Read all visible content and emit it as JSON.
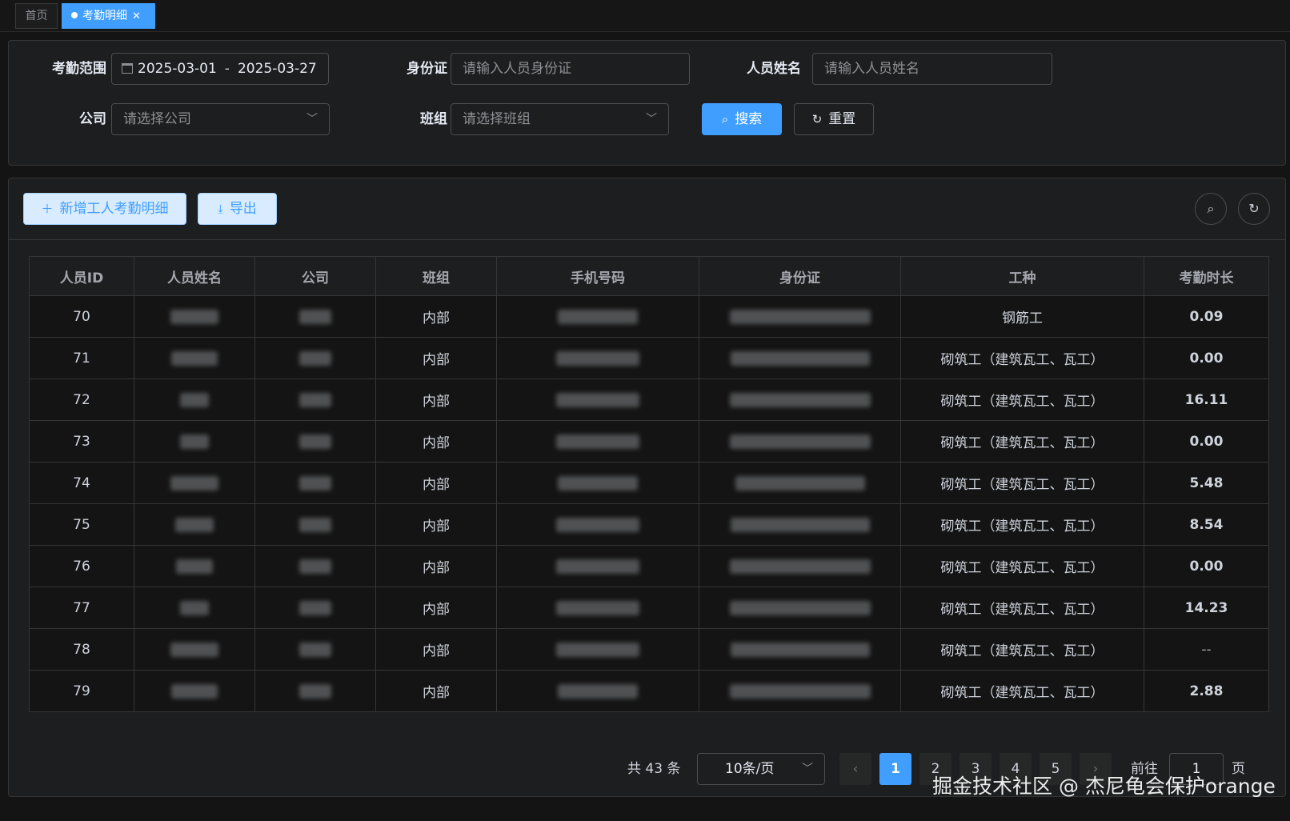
{
  "tabs": [
    {
      "label": "首页",
      "active": false
    },
    {
      "label": "考勤明细",
      "active": true
    }
  ],
  "search": {
    "range_label": "考勤范围",
    "date_start": "2025-03-01",
    "date_sep": "-",
    "date_end": "2025-03-27",
    "idcard_label": "身份证",
    "idcard_placeholder": "请输入人员身份证",
    "name_label": "人员姓名",
    "name_placeholder": "请输入人员姓名",
    "company_label": "公司",
    "company_placeholder": "请选择公司",
    "team_label": "班组",
    "team_placeholder": "请选择班组",
    "search_btn": "搜索",
    "reset_btn": "重置"
  },
  "toolbar": {
    "add_btn": "新增工人考勤明细",
    "export_btn": "导出"
  },
  "table": {
    "columns": [
      "人员ID",
      "人员姓名",
      "公司",
      "班组",
      "手机号码",
      "身份证",
      "工种",
      "考勤时长"
    ],
    "rows": [
      {
        "id": "70",
        "team": "内部",
        "trade": "钢筋工",
        "duration": "0.09"
      },
      {
        "id": "71",
        "team": "内部",
        "trade": "砌筑工（建筑瓦工、瓦工）",
        "duration": "0.00"
      },
      {
        "id": "72",
        "team": "内部",
        "trade": "砌筑工（建筑瓦工、瓦工）",
        "duration": "16.11"
      },
      {
        "id": "73",
        "team": "内部",
        "trade": "砌筑工（建筑瓦工、瓦工）",
        "duration": "0.00"
      },
      {
        "id": "74",
        "team": "内部",
        "trade": "砌筑工（建筑瓦工、瓦工）",
        "duration": "5.48"
      },
      {
        "id": "75",
        "team": "内部",
        "trade": "砌筑工（建筑瓦工、瓦工）",
        "duration": "8.54"
      },
      {
        "id": "76",
        "team": "内部",
        "trade": "砌筑工（建筑瓦工、瓦工）",
        "duration": "0.00"
      },
      {
        "id": "77",
        "team": "内部",
        "trade": "砌筑工（建筑瓦工、瓦工）",
        "duration": "14.23"
      },
      {
        "id": "78",
        "team": "内部",
        "trade": "砌筑工（建筑瓦工、瓦工）",
        "duration": "--"
      },
      {
        "id": "79",
        "team": "内部",
        "trade": "砌筑工（建筑瓦工、瓦工）",
        "duration": "2.88"
      }
    ]
  },
  "pagination": {
    "total_text": "共 43 条",
    "page_size": "10条/页",
    "pages": [
      "1",
      "2",
      "3",
      "4",
      "5"
    ],
    "current_page": "1",
    "prev_icon": "chevron-left-icon",
    "next_icon": "chevron-right-icon",
    "goto_label": "前往",
    "goto_value": "1",
    "page_suffix": "页"
  },
  "watermark": "掘金技术社区 @ 杰尼龟会保护orange",
  "colors": {
    "accent": "#409eff",
    "background": "#141414",
    "panel": "#1d1e1f"
  }
}
